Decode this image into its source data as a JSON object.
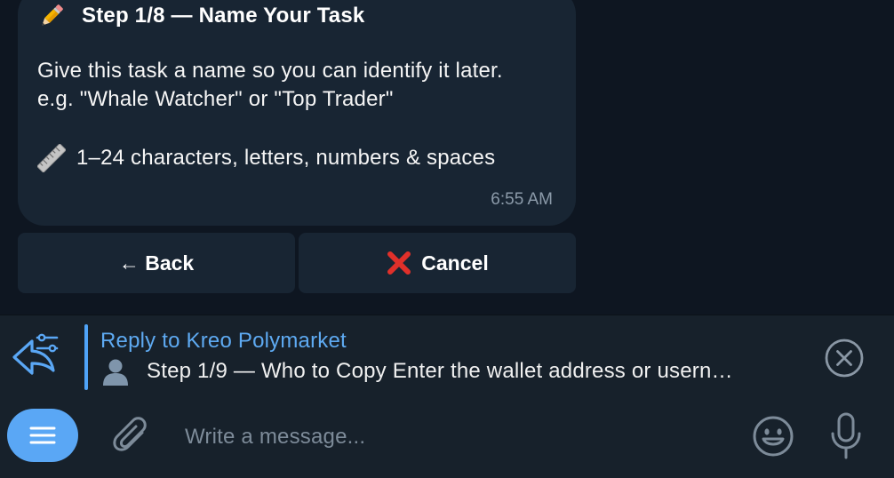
{
  "message": {
    "title": "Step 1/8 — Name Your Task",
    "line1": "Give this task a name so you can identify it later.",
    "line2": "e.g. \"Whale Watcher\" or \"Top Trader\"",
    "rule": "1–24 characters, letters, numbers & spaces",
    "time": "6:55 AM",
    "title_icon": "pencil-emoji",
    "rule_icon": "ruler-emoji"
  },
  "keyboard": {
    "back_label": "← Back",
    "cancel_label": "Cancel",
    "cancel_icon": "cross-mark-emoji"
  },
  "reply": {
    "to_label": "Reply to Kreo Polymarket",
    "snippet": "Step 1/9 — Who to Copy  Enter the wallet address or usern…",
    "snippet_icon": "bust-silhouette-emoji"
  },
  "composer": {
    "placeholder": "Write a message..."
  },
  "colors": {
    "accent": "#5aa7f5",
    "link": "#5eaaf2",
    "bubble": "#182533",
    "background": "#0e1621",
    "panel": "#17212b"
  }
}
